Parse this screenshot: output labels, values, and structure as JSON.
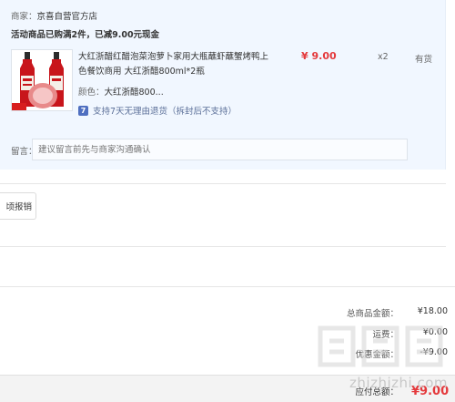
{
  "merchant": {
    "label": "商家：",
    "name": "京喜自营官方店"
  },
  "promotion": "活动商品已购满2件，已减9.00元现金",
  "product": {
    "title": "大红浙醋红醋泡菜泡萝卜家用大瓶蘸虾蘸蟹烤鸭上色餐饮商用 大红浙醋800ml*2瓶",
    "price": "¥ 9.00",
    "quantity": "x2",
    "stock": "有货",
    "color_label": "颜色：",
    "color_value": "大红浙醋800...",
    "return_policy": "支持7天无理由退货（拆封后不支持）",
    "return_icon_text": "7"
  },
  "note": {
    "label": "留言：",
    "placeholder": "建议留言前先与商家沟通确认"
  },
  "invoice": {
    "button_label": "顷报销"
  },
  "summary": {
    "total_label": "总商品金额：",
    "total_value": "¥18.00",
    "shipping_label": "运费：",
    "shipping_value": "¥0.00",
    "discount_label": "优惠金额：",
    "discount_value": "-¥9.00",
    "payable_label": "应付总额：",
    "payable_value": "¥9.00"
  },
  "watermark": {
    "text": "zhizhizhi.com"
  },
  "colors": {
    "accent": "#e4393c",
    "panel": "#f1f7ff",
    "link": "#5b6f98"
  }
}
